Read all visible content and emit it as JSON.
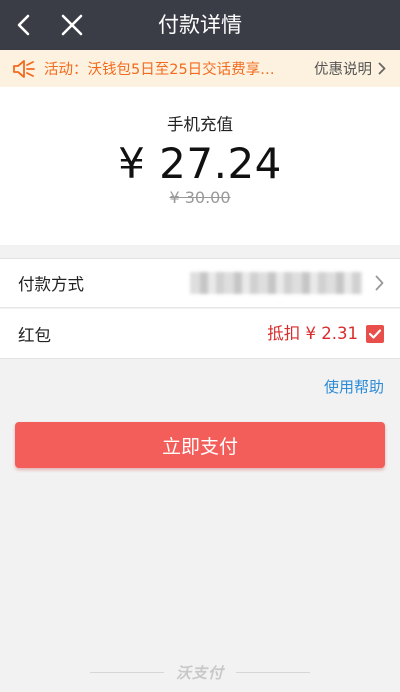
{
  "nav": {
    "title": "付款详情",
    "back_icon": "chevron-left-icon",
    "close_icon": "close-icon"
  },
  "notice": {
    "icon": "speaker-icon",
    "text": "活动：沃钱包5日至25日交话费享…",
    "link_label": "优惠说明"
  },
  "summary": {
    "product": "手机充值",
    "amount": "¥ 27.24",
    "original_amount": "¥ 30.00"
  },
  "payment_method": {
    "label": "付款方式"
  },
  "red_packet": {
    "label": "红包",
    "deduction": "抵扣 ¥ 2.31",
    "checked": true
  },
  "help_link": "使用帮助",
  "pay_button": "立即支付",
  "footer_brand": "沃支付",
  "colors": {
    "nav_bg": "#3b3d46",
    "notice_bg": "#fdf2df",
    "notice_text": "#f26a1e",
    "accent_red": "#f35e5a",
    "link_blue": "#2b8bd6"
  }
}
